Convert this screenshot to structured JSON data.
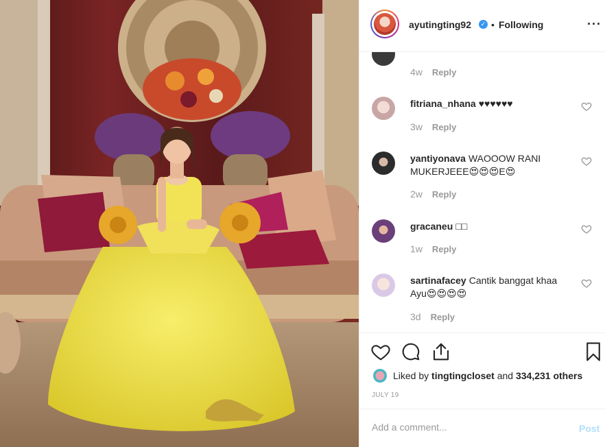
{
  "header": {
    "username": "ayutingting92",
    "separator": "•",
    "follow_status": "Following",
    "verified_glyph": "✓",
    "more_glyph": "···"
  },
  "comments": [
    {
      "username": "",
      "text": "",
      "age": "4w",
      "reply": "Reply",
      "partial": true
    },
    {
      "username": "fitriana_nhana",
      "text": "♥♥♥♥♥♥",
      "age": "3w",
      "reply": "Reply",
      "avatar_color": "#c9a6a6"
    },
    {
      "username": "yantiyonava",
      "text": "WAOOOW RANI MUKERJEEE😍😍😍E😍",
      "age": "2w",
      "reply": "Reply",
      "avatar_color": "#2c2c2c"
    },
    {
      "username": "gracaneu",
      "text": "□□",
      "age": "1w",
      "reply": "Reply",
      "avatar_color": "#6b3f7a"
    },
    {
      "username": "sartinafacey",
      "text": "Cantik banggat khaa Ayu😍😍😍😍",
      "age": "3d",
      "reply": "Reply",
      "avatar_color": "#d9c9e6"
    }
  ],
  "likes": {
    "prefix": "Liked by",
    "user": "tingtingcloset",
    "middle": "and",
    "count": "334,231 others"
  },
  "date": "JULY 19",
  "add_comment": {
    "placeholder": "Add a comment...",
    "post_label": "Post"
  },
  "icons": [
    "heart-icon",
    "comment-icon",
    "share-icon",
    "bookmark-icon",
    "more-options-icon",
    "verified-badge-icon"
  ],
  "colors": {
    "text": "#262626",
    "muted": "#999999",
    "link_blue_disabled": "#b2dffc",
    "verified": "#3897f0"
  }
}
